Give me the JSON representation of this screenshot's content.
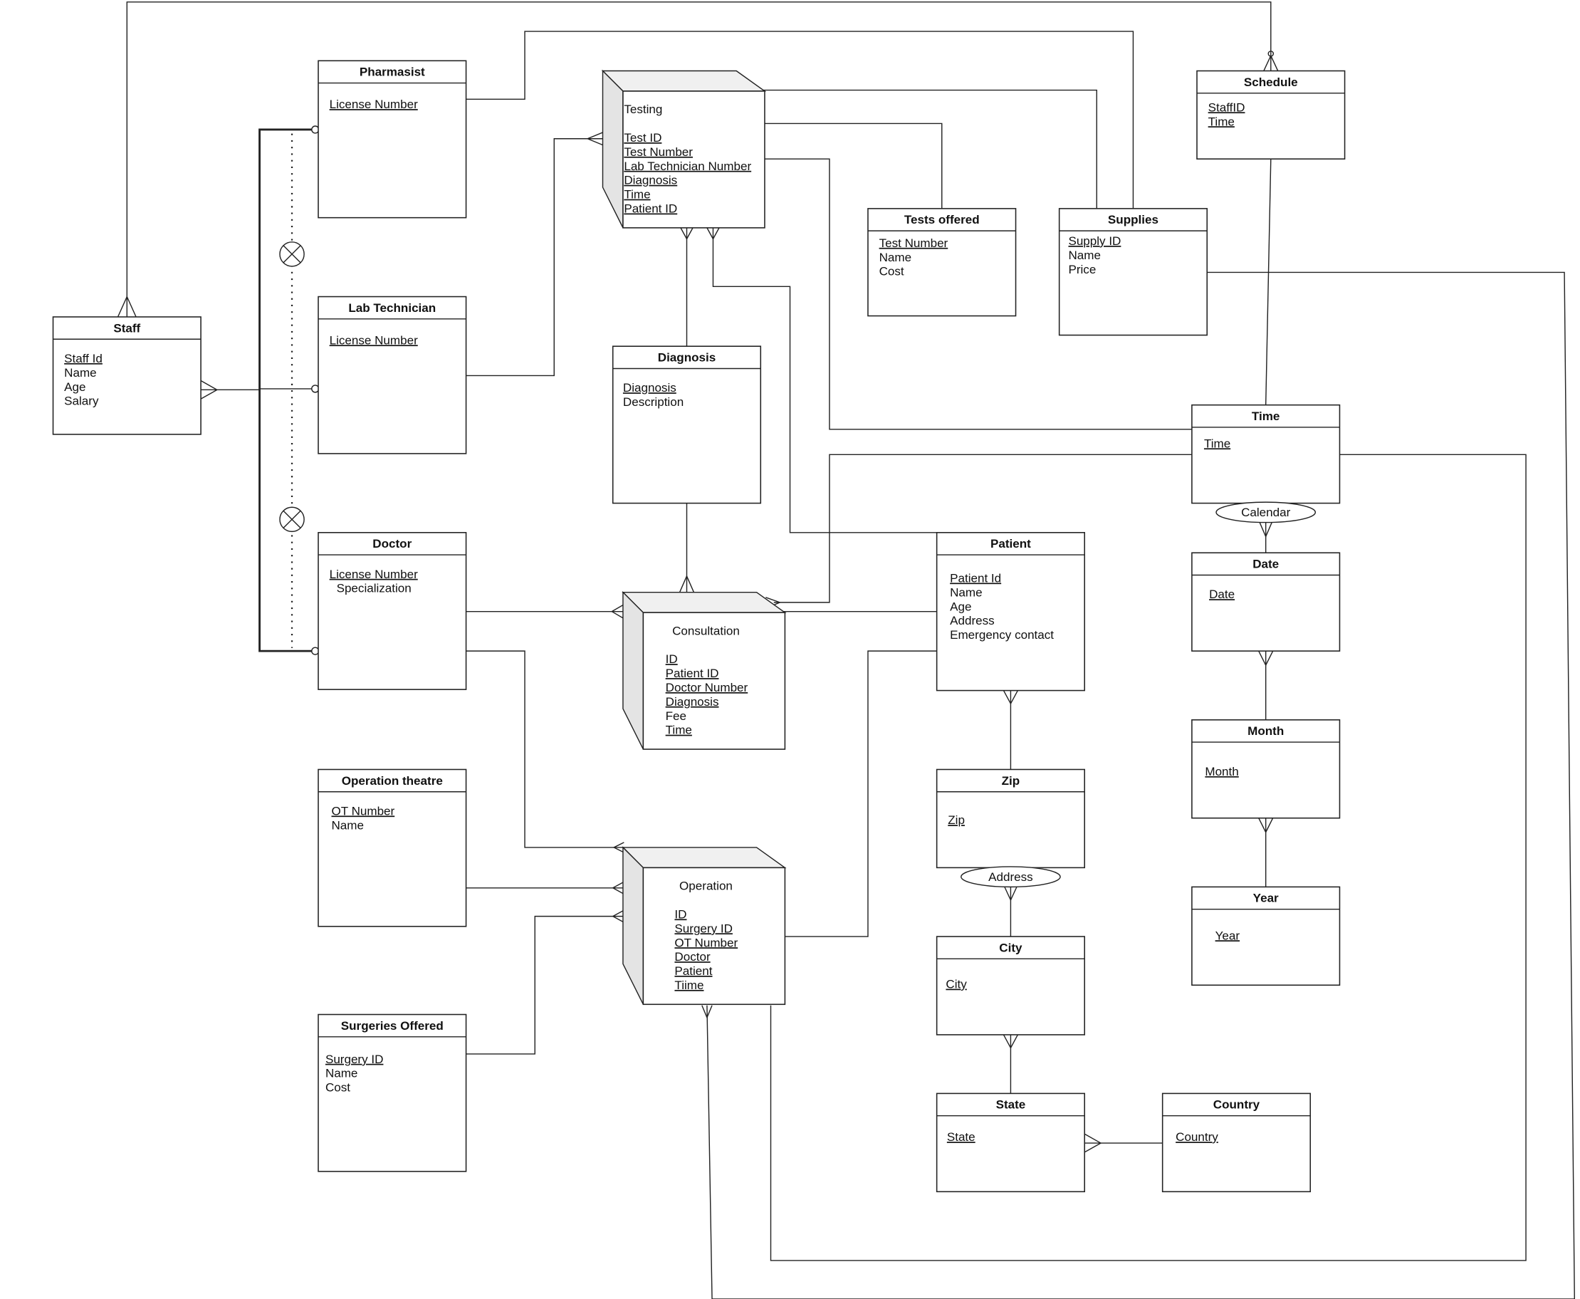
{
  "diagram": {
    "type": "entity-relationship",
    "entities": [
      {
        "id": "staff",
        "title": "Staff",
        "attributes": [
          {
            "text": "Staff Id",
            "key": true
          },
          {
            "text": "Name",
            "key": false
          },
          {
            "text": "Age",
            "key": false
          },
          {
            "text": "Salary",
            "key": false
          }
        ]
      },
      {
        "id": "pharmasist",
        "title": "Pharmasist",
        "attributes": [
          {
            "text": "License Number",
            "key": true
          }
        ]
      },
      {
        "id": "lab-technician",
        "title": "Lab Technician",
        "attributes": [
          {
            "text": "License Number",
            "key": true
          }
        ]
      },
      {
        "id": "doctor",
        "title": "Doctor",
        "attributes": [
          {
            "text": "License Number",
            "key": true
          },
          {
            "text": "Specialization",
            "key": false
          }
        ]
      },
      {
        "id": "operation-theatre",
        "title": "Operation theatre",
        "attributes": [
          {
            "text": "OT Number",
            "key": true
          },
          {
            "text": "Name",
            "key": false
          }
        ]
      },
      {
        "id": "surgeries-offered",
        "title": "Surgeries Offered",
        "attributes": [
          {
            "text": "Surgery ID",
            "key": true
          },
          {
            "text": "Name",
            "key": false
          },
          {
            "text": "Cost",
            "key": false
          }
        ]
      },
      {
        "id": "diagnosis",
        "title": "Diagnosis",
        "attributes": [
          {
            "text": "Diagnosis",
            "key": true
          },
          {
            "text": "Description",
            "key": false
          }
        ]
      },
      {
        "id": "tests-offered",
        "title": "Tests offered",
        "attributes": [
          {
            "text": "Test Number",
            "key": true
          },
          {
            "text": "Name",
            "key": false
          },
          {
            "text": "Cost",
            "key": false
          }
        ]
      },
      {
        "id": "supplies",
        "title": "Supplies",
        "attributes": [
          {
            "text": "Supply ID",
            "key": true
          },
          {
            "text": "Name",
            "key": false
          },
          {
            "text": "Price",
            "key": false
          }
        ]
      },
      {
        "id": "schedule",
        "title": "Schedule",
        "attributes": [
          {
            "text": "StaffID",
            "key": true
          },
          {
            "text": "Time",
            "key": true
          }
        ]
      },
      {
        "id": "time",
        "title": "Time",
        "attributes": [
          {
            "text": "Time",
            "key": true
          }
        ]
      },
      {
        "id": "date",
        "title": "Date",
        "attributes": [
          {
            "text": "Date",
            "key": true
          }
        ]
      },
      {
        "id": "month",
        "title": "Month",
        "attributes": [
          {
            "text": "Month",
            "key": true
          }
        ]
      },
      {
        "id": "year",
        "title": "Year",
        "attributes": [
          {
            "text": "Year",
            "key": true
          }
        ]
      },
      {
        "id": "patient",
        "title": "Patient",
        "attributes": [
          {
            "text": "Patient Id",
            "key": true
          },
          {
            "text": "Name",
            "key": false
          },
          {
            "text": "Age",
            "key": false
          },
          {
            "text": "Address",
            "key": false
          },
          {
            "text": "Emergency contact",
            "key": false
          }
        ]
      },
      {
        "id": "zip",
        "title": "Zip",
        "attributes": [
          {
            "text": "Zip",
            "key": true
          }
        ]
      },
      {
        "id": "city",
        "title": "City",
        "attributes": [
          {
            "text": "City",
            "key": true
          }
        ]
      },
      {
        "id": "state",
        "title": "State",
        "attributes": [
          {
            "text": "State",
            "key": true
          }
        ]
      },
      {
        "id": "country",
        "title": "Country",
        "attributes": [
          {
            "text": "Country",
            "key": true
          }
        ]
      }
    ],
    "associative_entities": [
      {
        "id": "testing",
        "title": "Testing",
        "attributes": [
          {
            "text": "Test ID",
            "key": true
          },
          {
            "text": "Test Number",
            "key": true
          },
          {
            "text": "Lab Technician Number",
            "key": true
          },
          {
            "text": "Diagnosis",
            "key": true
          },
          {
            "text": "Time",
            "key": true
          },
          {
            "text": "Patient ID",
            "key": true
          }
        ]
      },
      {
        "id": "consultation",
        "title": "Consultation",
        "attributes": [
          {
            "text": "ID",
            "key": true
          },
          {
            "text": "Patient ID",
            "key": true
          },
          {
            "text": "Doctor Number",
            "key": true
          },
          {
            "text": "Diagnosis",
            "key": true
          },
          {
            "text": "Fee",
            "key": false
          },
          {
            "text": "Time",
            "key": true
          }
        ]
      },
      {
        "id": "operation",
        "title": "Operation",
        "attributes": [
          {
            "text": "ID",
            "key": true
          },
          {
            "text": "Surgery ID",
            "key": true
          },
          {
            "text": "OT Number",
            "key": true
          },
          {
            "text": "Doctor",
            "key": true
          },
          {
            "text": "Patient",
            "key": true
          },
          {
            "text": "Tiime",
            "key": true
          }
        ]
      }
    ],
    "relationship_labels": [
      {
        "id": "calendar",
        "text": "Calendar"
      },
      {
        "id": "address",
        "text": "Address"
      }
    ]
  }
}
